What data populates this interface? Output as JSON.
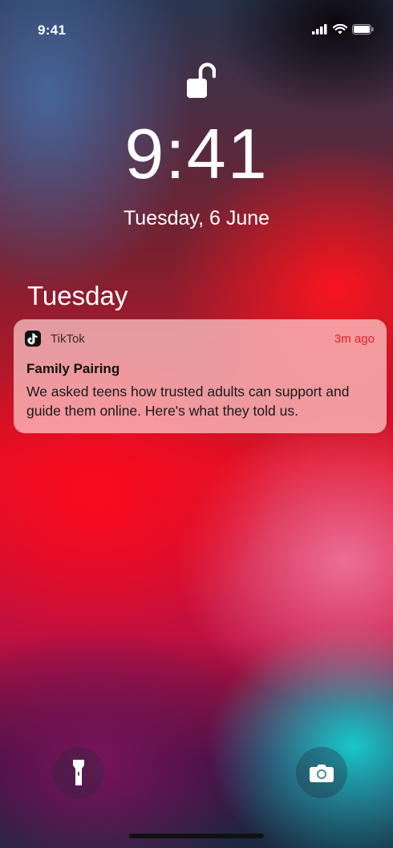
{
  "status_bar": {
    "time": "9:41"
  },
  "lock_screen": {
    "clock": "9:41",
    "date": "Tuesday, 6 June"
  },
  "section": {
    "day": "Tuesday"
  },
  "notification": {
    "app": "TikTok",
    "time": "3m ago",
    "title": "Family Pairing",
    "body": "We asked teens how trusted adults can support and guide them online. Here's what they told us."
  },
  "icons": {
    "lock": "unlocked-padlock-icon",
    "app": "tiktok-icon",
    "flashlight": "flashlight-icon",
    "camera": "camera-icon",
    "signal": "cellular-signal-icon",
    "wifi": "wifi-icon",
    "battery": "battery-icon"
  },
  "colors": {
    "notification_time": "#e0202a"
  }
}
